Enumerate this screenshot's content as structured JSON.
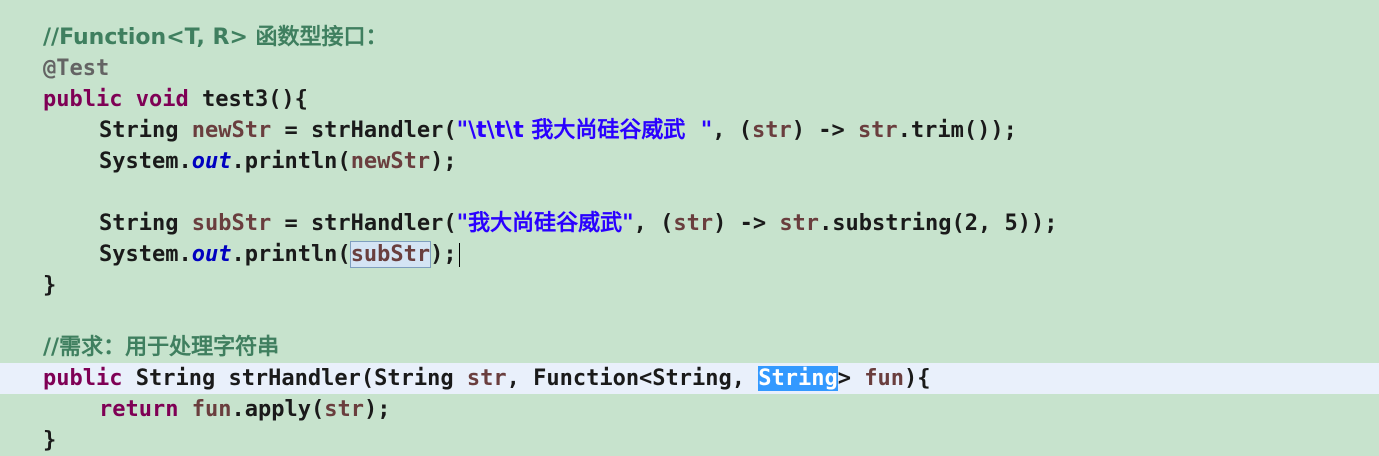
{
  "editor": {
    "lines": [
      {
        "tokens": [
          {
            "c": "cm",
            "t": "//Function<T, R> 函数型接口："
          }
        ]
      },
      {
        "tokens": [
          {
            "c": "an",
            "t": "@Test"
          }
        ]
      },
      {
        "tokens": [
          {
            "c": "kw",
            "t": "public"
          },
          {
            "c": "",
            "t": " "
          },
          {
            "c": "kw",
            "t": "void"
          },
          {
            "c": "",
            "t": " test3(){"
          }
        ]
      },
      {
        "tokens": [
          {
            "c": "",
            "t": "String "
          },
          {
            "c": "var",
            "t": "newStr"
          },
          {
            "c": "",
            "t": " = strHandler("
          },
          {
            "c": "str",
            "t": "\"\\t\\t\\t 我大尚硅谷威武  \""
          },
          {
            "c": "",
            "t": ", ("
          },
          {
            "c": "var",
            "t": "str"
          },
          {
            "c": "",
            "t": ") -> "
          },
          {
            "c": "var",
            "t": "str"
          },
          {
            "c": "",
            "t": ".trim());"
          }
        ]
      },
      {
        "tokens": [
          {
            "c": "",
            "t": "System."
          },
          {
            "c": "fld",
            "t": "out"
          },
          {
            "c": "",
            "t": ".println("
          },
          {
            "c": "var",
            "t": "newStr"
          },
          {
            "c": "",
            "t": ");"
          }
        ]
      },
      {
        "tokens": []
      },
      {
        "tokens": [
          {
            "c": "",
            "t": "String "
          },
          {
            "c": "var",
            "t": "subStr"
          },
          {
            "c": "",
            "t": " = strHandler("
          },
          {
            "c": "str",
            "t": "\"我大尚硅谷威武\""
          },
          {
            "c": "",
            "t": ", ("
          },
          {
            "c": "var",
            "t": "str"
          },
          {
            "c": "",
            "t": ") -> "
          },
          {
            "c": "var",
            "t": "str"
          },
          {
            "c": "",
            "t": ".substring(2, 5));"
          }
        ]
      },
      {
        "tokens": [
          {
            "c": "",
            "t": "System."
          },
          {
            "c": "fld",
            "t": "out"
          },
          {
            "c": "",
            "t": ".println("
          },
          {
            "c": "var occ",
            "t": "subStr"
          },
          {
            "c": "",
            "t": ");"
          }
        ]
      },
      {
        "tokens": [
          {
            "c": "",
            "t": "}"
          }
        ]
      },
      {
        "tokens": []
      },
      {
        "tokens": [
          {
            "c": "cm",
            "t": "//需求：用于处理字符串"
          }
        ]
      },
      {
        "tokens": [
          {
            "c": "kw",
            "t": "public"
          },
          {
            "c": "",
            "t": " String strHandler(String "
          },
          {
            "c": "var",
            "t": "str"
          },
          {
            "c": "",
            "t": ", Function<String, "
          },
          {
            "c": "hl-sel",
            "t": "String"
          },
          {
            "c": "",
            "t": "> "
          },
          {
            "c": "var",
            "t": "fun"
          },
          {
            "c": "",
            "t": "){"
          }
        ]
      },
      {
        "tokens": [
          {
            "c": "kw",
            "t": "return"
          },
          {
            "c": "",
            "t": " "
          },
          {
            "c": "var",
            "t": "fun"
          },
          {
            "c": "",
            "t": ".apply("
          },
          {
            "c": "var",
            "t": "str"
          },
          {
            "c": "",
            "t": ");"
          }
        ]
      },
      {
        "tokens": [
          {
            "c": "",
            "t": "}"
          }
        ]
      }
    ]
  }
}
